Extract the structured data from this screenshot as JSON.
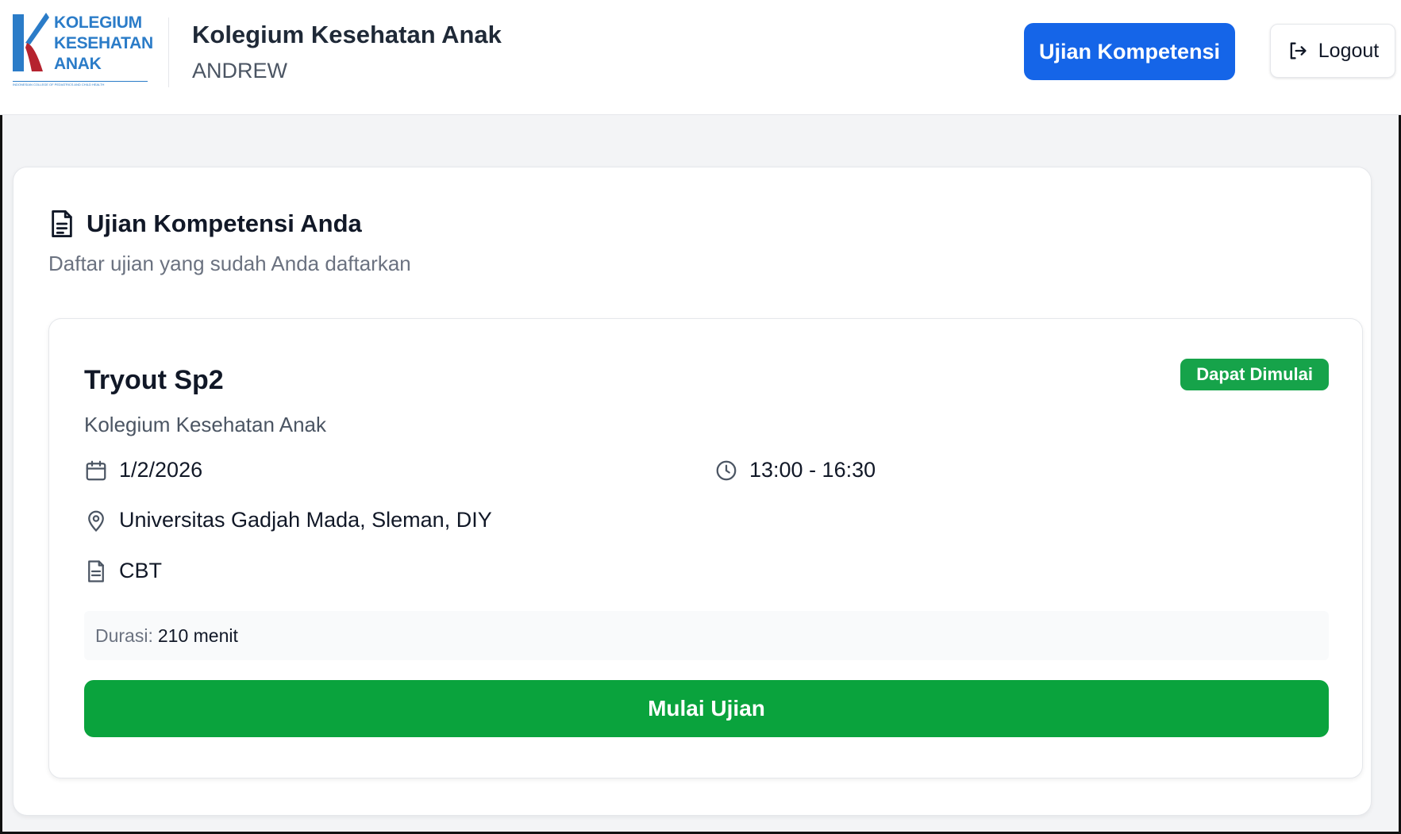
{
  "header": {
    "logo": {
      "line1": "KOLEGIUM",
      "line2": "KESEHATAN",
      "line3": "ANAK",
      "tagline": "INDONESIAN COLLEGE OF PEDIATRICS AND CHILD HEALTH"
    },
    "app_title": "Kolegium Kesehatan Anak",
    "user_name": "ANDREW",
    "nav_button_label": "Ujian Kompetensi",
    "logout_label": "Logout"
  },
  "main": {
    "section_title": "Ujian Kompetensi Anda",
    "section_subtitle": "Daftar ujian yang sudah Anda daftarkan",
    "exams": [
      {
        "title": "Tryout Sp2",
        "organizer": "Kolegium Kesehatan Anak",
        "status_badge": "Dapat Dimulai",
        "date": "1/2/2026",
        "time": "13:00 - 16:30",
        "location": "Universitas Gadjah Mada, Sleman, DIY",
        "type": "CBT",
        "duration_label": "Durasi:",
        "duration_value": "210 menit",
        "start_button_label": "Mulai Ujian"
      }
    ]
  },
  "colors": {
    "primary_blue": "#1565e8",
    "success_green": "#0aa33d",
    "badge_green": "#16a34a",
    "logo_blue": "#2b7cc8",
    "logo_red": "#b5232f"
  },
  "icons": {
    "section": "document-icon",
    "date": "calendar-icon",
    "time": "clock-icon",
    "location": "map-pin-icon",
    "type": "file-icon",
    "logout": "logout-icon"
  }
}
